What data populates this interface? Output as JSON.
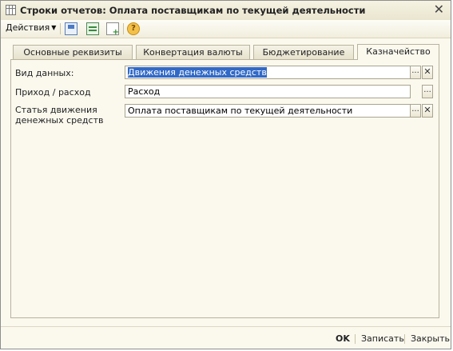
{
  "window": {
    "title": "Строки отчетов: Оплата поставщикам по текущей деятельности"
  },
  "toolbar": {
    "actions_label": "Действия",
    "help_symbol": "?"
  },
  "tabs": [
    {
      "label": "Основные реквизиты",
      "active": false
    },
    {
      "label": "Конвертация валюты",
      "active": false
    },
    {
      "label": "Бюджетирование",
      "active": false
    },
    {
      "label": "Казначейство",
      "active": true
    }
  ],
  "form": {
    "data_type": {
      "label": "Вид данных:",
      "value": "Движения денежных средств"
    },
    "direction": {
      "label": "Приход / расход",
      "value": "Расход"
    },
    "article": {
      "label_line1": "Статья движения",
      "label_line2": "денежных средств",
      "value": "Оплата поставщикам по текущей деятельности"
    }
  },
  "buttons": {
    "select": "...",
    "clear": "✕"
  },
  "footer": {
    "ok": "OK",
    "save": "Записать",
    "close": "Закрыть"
  },
  "colors": {
    "selection": "#3169c6",
    "background": "#fbf9ee"
  }
}
